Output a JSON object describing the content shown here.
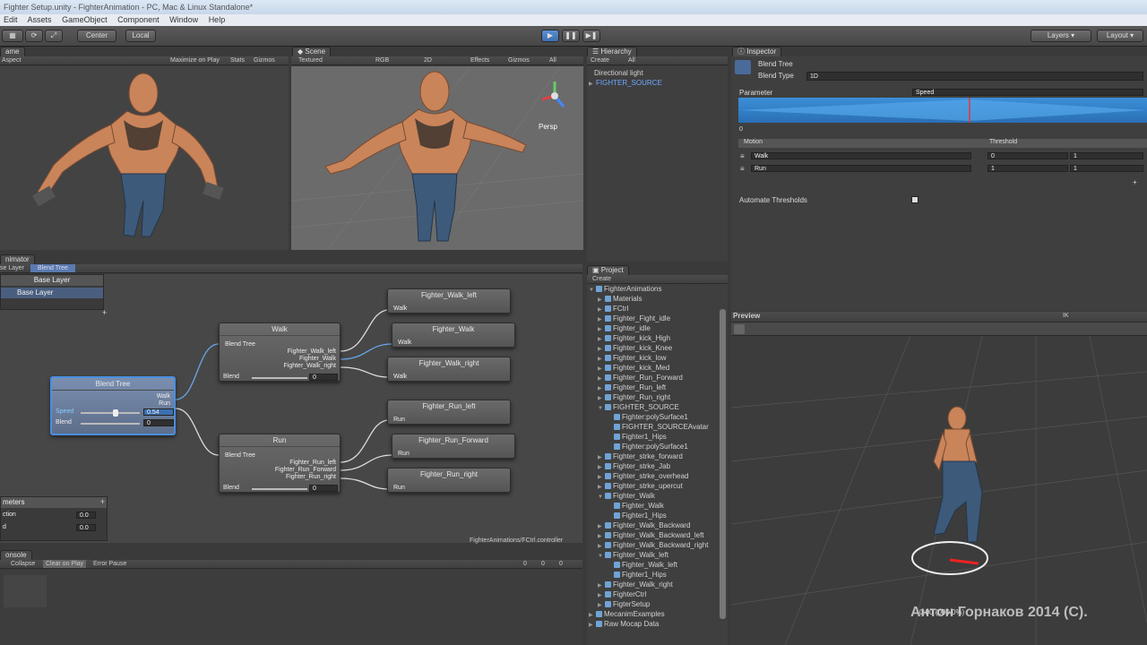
{
  "window": {
    "title": "Fighter Setup.unity - FighterAnimation - PC, Mac & Linux Standalone*"
  },
  "menu": [
    "Edit",
    "Assets",
    "GameObject",
    "Component",
    "Window",
    "Help"
  ],
  "toolbar": {
    "center": "Center",
    "local": "Local",
    "layers": "Layers",
    "layout": "Layout"
  },
  "game": {
    "tab": "ame",
    "aspect": "Aspect",
    "maximize": "Maximize on Play",
    "stats": "Stats",
    "gizmos": "Gizmos"
  },
  "scene": {
    "tab": "Scene",
    "shading": "Textured",
    "rgb": "RGB",
    "mode2d": "2D",
    "effects": "Effects",
    "gizmos": "Gizmos",
    "all": "All",
    "persp": "Persp"
  },
  "hierarchy": {
    "tab": "Hierarchy",
    "create": "Create",
    "all": "All",
    "items": [
      "Directional light",
      "FIGHTER_SOURCE"
    ]
  },
  "inspector": {
    "tab": "Inspector",
    "name": "Blend Tree",
    "blend_type_label": "Blend Type",
    "blend_type": "1D",
    "parameter_label": "Parameter",
    "parameter": "Speed",
    "min": "0",
    "col_motion": "Motion",
    "col_threshold": "Threshold",
    "motions": [
      {
        "name": "Walk",
        "threshold": "0",
        "speed": "1"
      },
      {
        "name": "Run",
        "threshold": "1",
        "speed": "1"
      }
    ],
    "automate": "Automate Thresholds"
  },
  "preview": {
    "label": "Preview",
    "ik": "IK",
    "status": "0:00 (000.0%)",
    "watermark": "Антон Горнаков 2014 (С)."
  },
  "animator": {
    "tab": "nimator",
    "layer": "se Layer",
    "crumb": "Blend Tree",
    "layers_header": "Base Layer",
    "layer_item": "Base Layer",
    "parameters": "meters",
    "params": [
      {
        "name": "ction",
        "value": "0.0"
      },
      {
        "name": "d",
        "value": "0.0"
      }
    ],
    "path": "FighterAnimations/FCtrl.controller"
  },
  "graph": {
    "root": {
      "title": "Blend Tree",
      "speed_label": "Speed",
      "speed_value": "0.54",
      "blend_label": "Blend",
      "blend_value": "0",
      "out1": "Walk",
      "out2": "Run"
    },
    "walk": {
      "title": "Walk",
      "in": "Blend Tree",
      "outs": [
        "Fighter_Walk_left",
        "Fighter_Walk",
        "Fighter_Walk_right"
      ],
      "blend": "Blend",
      "value": "0"
    },
    "run": {
      "title": "Run",
      "in": "Blend Tree",
      "outs": [
        "Fighter_Run_left",
        "Fighter_Run_Forward",
        "Fighter_Run_right"
      ],
      "blend": "Blend",
      "value": "0"
    },
    "clips": [
      {
        "title": "Fighter_Walk_left",
        "port": "Walk"
      },
      {
        "title": "Fighter_Walk",
        "port": "Walk"
      },
      {
        "title": "Fighter_Walk_right",
        "port": "Walk"
      },
      {
        "title": "Fighter_Run_left",
        "port": "Run"
      },
      {
        "title": "Fighter_Run_Forward",
        "port": "Run"
      },
      {
        "title": "Fighter_Run_right",
        "port": "Run"
      }
    ]
  },
  "console": {
    "tab": "onsole",
    "buttons": [
      "Collapse",
      "Clear on Play",
      "Error Pause"
    ],
    "counts": [
      "0",
      "0",
      "0"
    ]
  },
  "project": {
    "tab": "Project",
    "create": "Create",
    "items": [
      {
        "t": "FighterAnimations",
        "d": 0,
        "o": true
      },
      {
        "t": "Materials",
        "d": 1
      },
      {
        "t": "FCtrl",
        "d": 1
      },
      {
        "t": "Fighter_Fight_idle",
        "d": 1
      },
      {
        "t": "Fighter_idle",
        "d": 1
      },
      {
        "t": "Fighter_kick_High",
        "d": 1
      },
      {
        "t": "Fighter_kick_Knee",
        "d": 1
      },
      {
        "t": "Fighter_kick_low",
        "d": 1
      },
      {
        "t": "Fighter_kick_Med",
        "d": 1
      },
      {
        "t": "Fighter_Run_Forward",
        "d": 1
      },
      {
        "t": "Fighter_Run_left",
        "d": 1
      },
      {
        "t": "Fighter_Run_right",
        "d": 1
      },
      {
        "t": "FIGHTER_SOURCE",
        "d": 1,
        "o": true
      },
      {
        "t": "Fighter:polySurface1",
        "d": 2
      },
      {
        "t": "FIGHTER_SOURCEAvatar",
        "d": 2
      },
      {
        "t": "Fighter1_Hips",
        "d": 2
      },
      {
        "t": "Fighter:polySurface1",
        "d": 2
      },
      {
        "t": "Fighter_strke_forward",
        "d": 1
      },
      {
        "t": "Fighter_strke_Jab",
        "d": 1
      },
      {
        "t": "Fighter_strke_overhead",
        "d": 1
      },
      {
        "t": "Fighter_strke_upercut",
        "d": 1
      },
      {
        "t": "Fighter_Walk",
        "d": 1,
        "o": true
      },
      {
        "t": "Fighter_Walk",
        "d": 2
      },
      {
        "t": "Fighter1_Hips",
        "d": 2
      },
      {
        "t": "Fighter_Walk_Backward",
        "d": 1
      },
      {
        "t": "Fighter_Walk_Backward_left",
        "d": 1
      },
      {
        "t": "Fighter_Walk_Backward_right",
        "d": 1
      },
      {
        "t": "Fighter_Walk_left",
        "d": 1,
        "o": true
      },
      {
        "t": "Fighter_Walk_left",
        "d": 2
      },
      {
        "t": "Fighter1_Hips",
        "d": 2
      },
      {
        "t": "Fighter_Walk_right",
        "d": 1
      },
      {
        "t": "FighterCtrl",
        "d": 1
      },
      {
        "t": "FigterSetup",
        "d": 1
      },
      {
        "t": "MecanimExamples",
        "d": 0
      },
      {
        "t": "Raw Mocap Data",
        "d": 0
      }
    ]
  }
}
